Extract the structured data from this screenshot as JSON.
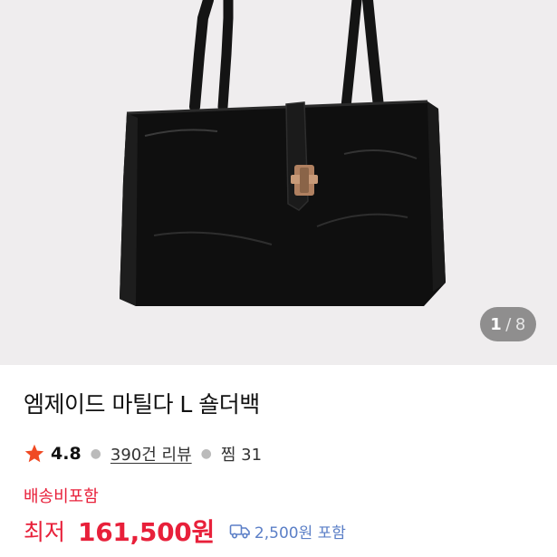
{
  "gallery": {
    "current_page": "1",
    "separator": "/",
    "total_pages": "8",
    "image_subject": "black leather shoulder bag"
  },
  "product": {
    "title": "엠제이드 마틸다 L 숄더백",
    "rating": "4.8",
    "review_link": "390건 리뷰",
    "wish_count": "찜 31",
    "shipping_note": "배송비포함",
    "price_label": "최저",
    "price_value": "161,500원",
    "delivery_fee": "2,500원 포함"
  },
  "colors": {
    "accent_red": "#e8203a",
    "star": "#f04a23",
    "delivery_blue": "#5b7fc7"
  },
  "icons": [
    "star-icon",
    "truck-icon"
  ]
}
